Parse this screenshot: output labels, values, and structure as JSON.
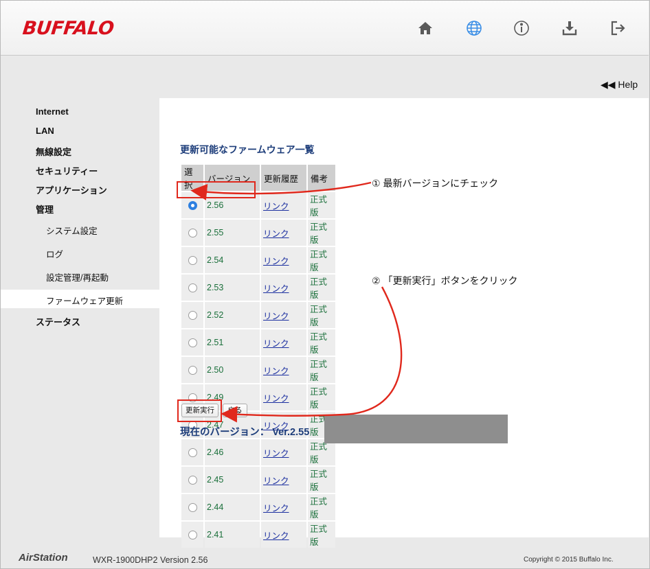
{
  "header": {
    "logo_text": "BUFFALO",
    "icons": [
      "home-icon",
      "globe-icon",
      "info-icon",
      "download-icon",
      "logout-icon"
    ],
    "accent": "#d8101d",
    "active_icon_color": "#3a8ee6"
  },
  "help_label": "◀◀ Help",
  "sidebar": {
    "items": [
      "Internet",
      "LAN",
      "無線設定",
      "セキュリティー",
      "アプリケーション",
      "管理"
    ],
    "sub_items": [
      "システム設定",
      "ログ",
      "設定管理/再起動",
      "ファームウェア更新"
    ],
    "after_items": [
      "ステータス"
    ],
    "active_sub": "ファームウェア更新"
  },
  "main": {
    "title": "更新可能なファームウェア一覧",
    "columns": [
      "選択",
      "バージョン",
      "更新履歴",
      "備考"
    ],
    "rows": [
      {
        "version": "2.56",
        "link": "リンク",
        "note": "正式版",
        "selected": true
      },
      {
        "version": "2.55",
        "link": "リンク",
        "note": "正式版",
        "selected": false
      },
      {
        "version": "2.54",
        "link": "リンク",
        "note": "正式版",
        "selected": false
      },
      {
        "version": "2.53",
        "link": "リンク",
        "note": "正式版",
        "selected": false
      },
      {
        "version": "2.52",
        "link": "リンク",
        "note": "正式版",
        "selected": false
      },
      {
        "version": "2.51",
        "link": "リンク",
        "note": "正式版",
        "selected": false
      },
      {
        "version": "2.50",
        "link": "リンク",
        "note": "正式版",
        "selected": false
      },
      {
        "version": "2.49",
        "link": "リンク",
        "note": "正式版",
        "selected": false
      },
      {
        "version": "2.47",
        "link": "リンク",
        "note": "正式版",
        "selected": false
      },
      {
        "version": "2.46",
        "link": "リンク",
        "note": "正式版",
        "selected": false
      },
      {
        "version": "2.45",
        "link": "リンク",
        "note": "正式版",
        "selected": false
      },
      {
        "version": "2.44",
        "link": "リンク",
        "note": "正式版",
        "selected": false
      },
      {
        "version": "2.41",
        "link": "リンク",
        "note": "正式版",
        "selected": false
      }
    ],
    "update_button": "更新実行",
    "back_button": "戻る",
    "current_version": "現在のバージョン： Ver.2.55"
  },
  "annotations": {
    "step1": "① 最新バージョンにチェック",
    "step2": "② 「更新実行」ボタンをクリック",
    "color": "#e0281c"
  },
  "footer": {
    "brand": "AirStation",
    "model": "WXR-1900DHP2   Version 2.56",
    "copyright": "Copyright © 2015 Buffalo Inc."
  }
}
